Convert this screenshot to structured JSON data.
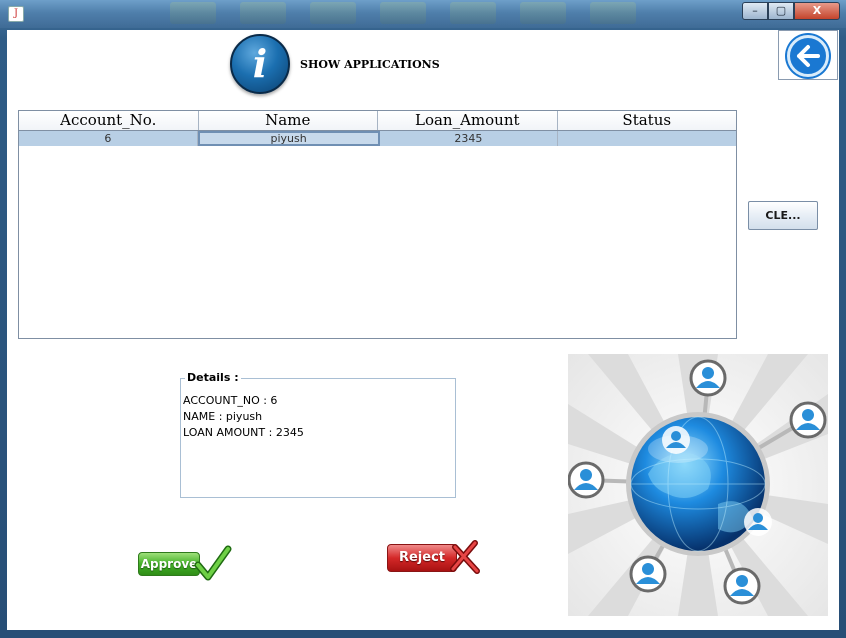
{
  "window": {
    "app_icon_glyph": "J",
    "minimize_glyph": "–",
    "maximize_glyph": "▢",
    "close_glyph": "X"
  },
  "header": {
    "icon_glyph": "i",
    "title": "SHOW APPLICATIONS"
  },
  "table": {
    "columns": [
      "Account_No.",
      "Name",
      "Loan_Amount",
      "Status"
    ],
    "rows": [
      {
        "account_no": "6",
        "name": "piyush",
        "loan_amount": "2345",
        "status": ""
      }
    ]
  },
  "buttons": {
    "clear_label": "CLE...",
    "approve_label": "Approve",
    "reject_label": "Reject"
  },
  "details": {
    "legend": "Details :",
    "line1": "ACCOUNT_NO : 6",
    "line2": "NAME : piyush",
    "line3": "LOAN AMOUNT : 2345"
  },
  "colors": {
    "selected_row": "#b8cfe5",
    "back_button": "#1a78d2",
    "approve": "#43b027",
    "reject": "#d42828"
  },
  "icons": {
    "header": "info-icon",
    "back": "back-arrow-icon",
    "approve": "checkmark-icon",
    "reject": "x-mark-icon",
    "illustration": "globe-network-illustration"
  }
}
